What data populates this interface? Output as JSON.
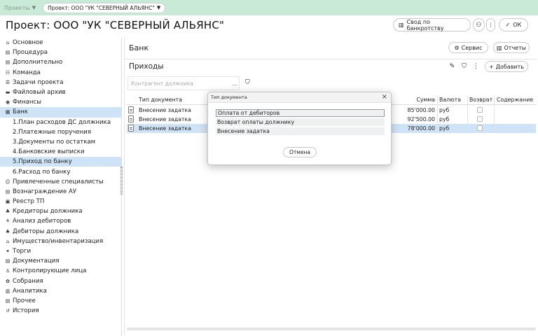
{
  "topbar": {
    "projects_label": "Проекты",
    "project_pill": "Проект: ООО \"УК \"СЕВЕРНЫЙ АЛЬЯНС\""
  },
  "header": {
    "title": "Проект: ООО \"УК \"СЕВЕРНЫЙ АЛЬЯНС\"",
    "summary_button": "Свод по банкротству",
    "ok_button": "ОК"
  },
  "sidebar": {
    "items": [
      {
        "label": "Основное",
        "icon": "home-icon"
      },
      {
        "label": "Процедура",
        "icon": "document-icon"
      },
      {
        "label": "Дополнительно",
        "icon": "document-icon"
      },
      {
        "label": "Команда",
        "icon": "team-icon"
      },
      {
        "label": "Задачи проекта",
        "icon": "list-icon"
      },
      {
        "label": "Файловый архив",
        "icon": "folder-icon"
      },
      {
        "label": "Финансы",
        "icon": "finance-icon"
      },
      {
        "label": "Банк",
        "icon": "bank-icon"
      },
      {
        "label": "1.План расходов ДС должника",
        "icon": ""
      },
      {
        "label": "2.Платежные поручения",
        "icon": ""
      },
      {
        "label": "3.Документы по остаткам",
        "icon": ""
      },
      {
        "label": "4.Банковские выписки",
        "icon": ""
      },
      {
        "label": "5.Приход по банку",
        "icon": ""
      },
      {
        "label": "6.Расход по банку",
        "icon": ""
      },
      {
        "label": "Привлеченные специалисты",
        "icon": "specialists-icon"
      },
      {
        "label": "Вознаграждение АУ",
        "icon": "document-icon"
      },
      {
        "label": "Реестр ТП",
        "icon": "registry-icon"
      },
      {
        "label": "Кредиторы должника",
        "icon": "creditors-icon"
      },
      {
        "label": "Анализ дебиторов",
        "icon": "analysis-icon"
      },
      {
        "label": "Дебиторы должника",
        "icon": "debtors-icon"
      },
      {
        "label": "Имущество/инвентаризация",
        "icon": "property-icon"
      },
      {
        "label": "Торги",
        "icon": "auction-icon"
      },
      {
        "label": "Документация",
        "icon": "document-icon"
      },
      {
        "label": "Контролирующие лица",
        "icon": "person-icon"
      },
      {
        "label": "Собрания",
        "icon": "meeting-icon"
      },
      {
        "label": "Аналитика",
        "icon": "chart-icon"
      },
      {
        "label": "Прочее",
        "icon": "document-icon"
      },
      {
        "label": "История",
        "icon": "history-icon"
      }
    ]
  },
  "main": {
    "section_title": "Банк",
    "service_button": "Сервис",
    "reports_button": "Отчеты",
    "subsection_title": "Приходы",
    "add_button": "Добавить",
    "filter_placeholder": "Контрагент должника",
    "table": {
      "columns": {
        "type": "Тип документа",
        "sum": "Сумма",
        "currency": "Валюта",
        "return": "Возврат",
        "content": "Содержание"
      },
      "rows": [
        {
          "type": "Внесение задатка",
          "sum": "85'000.00",
          "currency": "руб"
        },
        {
          "type": "Внесение задатка",
          "sum": "92'500.00",
          "currency": "руб"
        },
        {
          "type": "Внесение задатка",
          "sum": "78'000.00",
          "currency": "руб"
        }
      ]
    }
  },
  "modal": {
    "title": "Тип документа",
    "options": [
      "Оплата от дебиторов",
      "Возврат оплаты должнику",
      "Внесение задатка"
    ],
    "cancel": "Отмена"
  },
  "colors": {
    "topbar_bg": "#c8ead6",
    "selection_bg": "#cfe3f6"
  }
}
